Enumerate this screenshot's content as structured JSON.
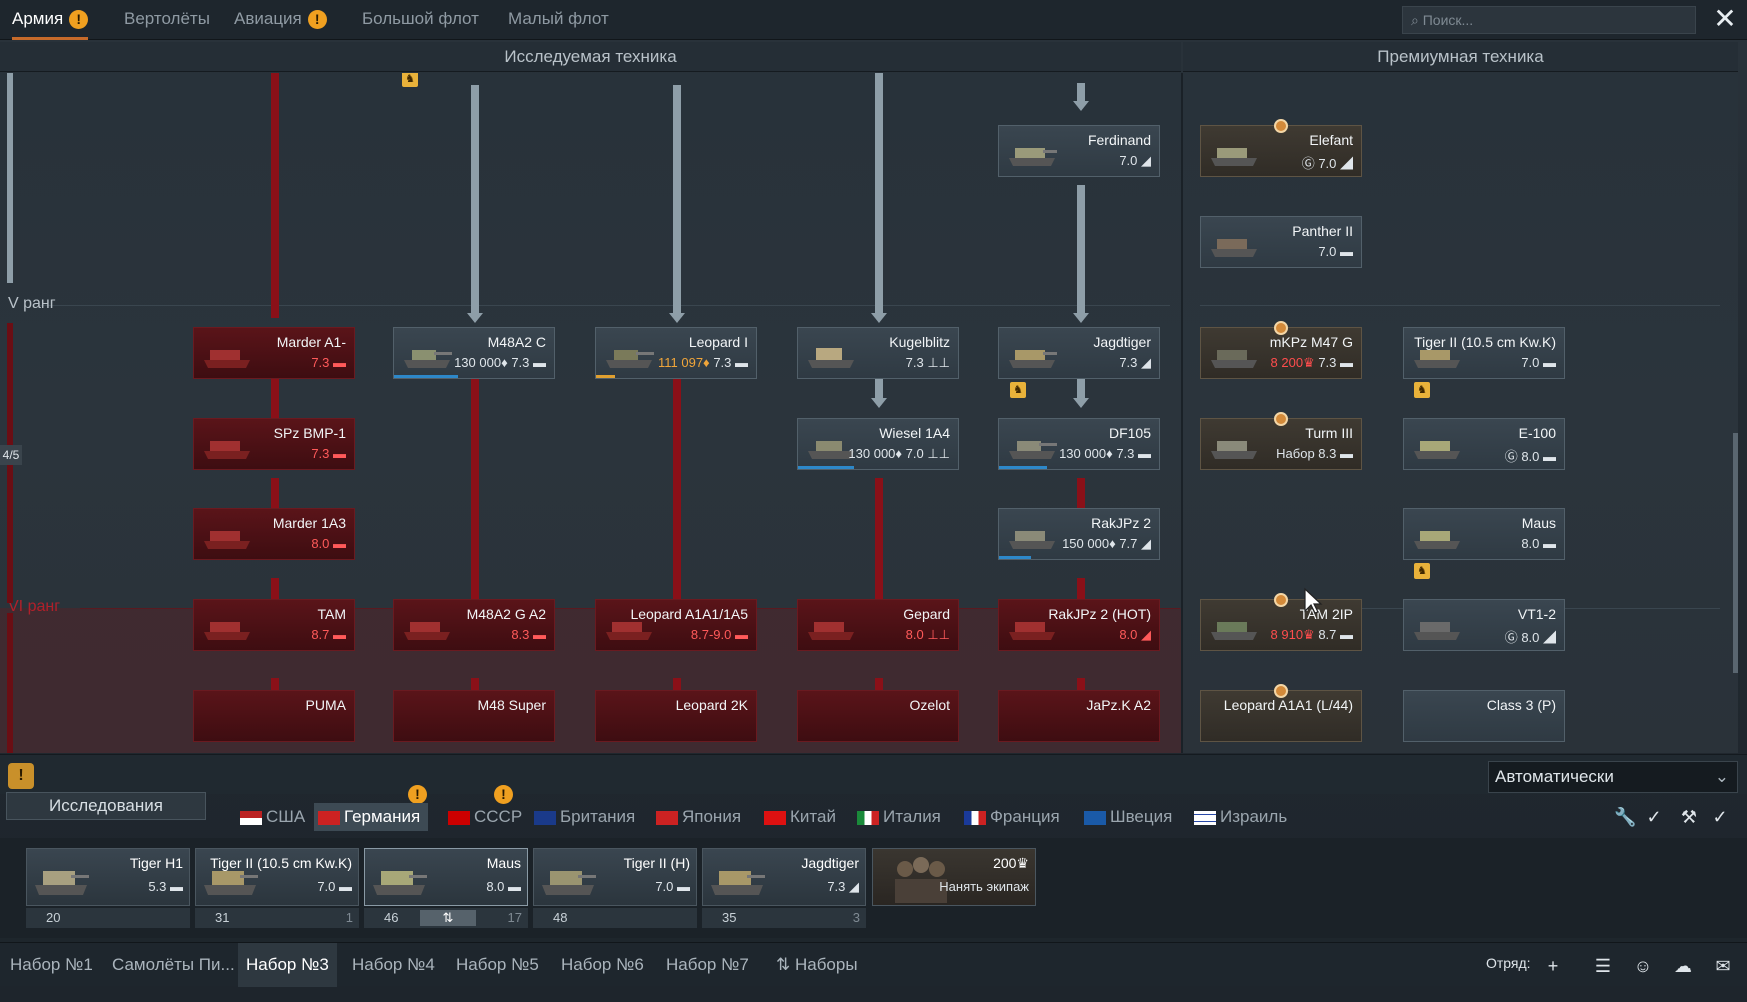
{
  "top_tabs": [
    {
      "label": "Армия",
      "warn": true
    },
    {
      "label": "Вертолёты",
      "warn": false
    },
    {
      "label": "Авиация",
      "warn": true
    },
    {
      "label": "Большой флот",
      "warn": false
    },
    {
      "label": "Малый флот",
      "warn": false
    }
  ],
  "warn_glyph": "!",
  "search_placeholder": "Поиск...",
  "close_glyph": "✕",
  "headers": {
    "research": "Исследуемая техника",
    "premium": "Премиумная техника"
  },
  "ranks": {
    "r5": "V ранг",
    "r6": "VI ранг"
  },
  "page_indicator": "4/5",
  "vehicles": [
    {
      "name": "Ferdinand",
      "stats": "7.0 ◢",
      "kind": "normal"
    },
    {
      "name": "Marder A1-",
      "stats": "7.3 ▬",
      "kind": "red"
    },
    {
      "name": "M48A2 C",
      "stats": "130 000♦ 7.3 ▬",
      "kind": "normal"
    },
    {
      "name": "Leopard I",
      "stats_gold": "111 097♦",
      "stats": " 7.3 ▬",
      "kind": "normal"
    },
    {
      "name": "Kugelblitz",
      "stats": "7.3 ⊥⊥",
      "kind": "normal"
    },
    {
      "name": "Jagdtiger",
      "stats": "7.3 ◢",
      "kind": "normal"
    },
    {
      "name": "SPz BMP-1",
      "stats": "7.3 ▬",
      "kind": "red"
    },
    {
      "name": "Wiesel 1A4",
      "stats": "130 000♦ 7.0 ⊥⊥",
      "kind": "normal"
    },
    {
      "name": "DF105",
      "stats": "130 000♦ 7.3 ▬",
      "kind": "normal"
    },
    {
      "name": "Marder 1A3",
      "stats": "8.0 ▬",
      "kind": "red"
    },
    {
      "name": "RakJPz 2",
      "stats": "150 000♦ 7.7 ◢",
      "kind": "normal"
    },
    {
      "name": "TAM",
      "stats": "8.7 ▬",
      "kind": "red"
    },
    {
      "name": "M48A2 G A2",
      "stats": "8.3 ▬",
      "kind": "red"
    },
    {
      "name": "Leopard A1A1/1A5",
      "stats": "8.7-9.0 ▬",
      "kind": "red"
    },
    {
      "name": "Gepard",
      "stats": "8.0 ⊥⊥",
      "kind": "red"
    },
    {
      "name": "RakJPz 2 (HOT)",
      "stats": "8.0 ◢",
      "kind": "red"
    },
    {
      "name": "PUMA",
      "stats": "",
      "kind": "red"
    },
    {
      "name": "M48 Super",
      "stats": "",
      "kind": "red"
    },
    {
      "name": "Leopard 2K",
      "stats": "",
      "kind": "red"
    },
    {
      "name": "Ozelot",
      "stats": "",
      "kind": "red"
    },
    {
      "name": "JaPz.K A2",
      "stats": "",
      "kind": "red"
    }
  ],
  "premium": [
    {
      "name": "Elefant",
      "stats": "Ⓖ 7.0 ◢"
    },
    {
      "name": "Panther II",
      "stats": "7.0 ▬"
    },
    {
      "name": "mKPz M47 G",
      "stats_red": "8 200♛",
      "stats": " 7.3 ▬"
    },
    {
      "name": "Tiger II (10.5 cm Kw.K)",
      "stats": "7.0 ▬"
    },
    {
      "name": "Turm III",
      "stats": "Набор 8.3 ▬"
    },
    {
      "name": "E-100",
      "stats": "Ⓖ 8.0 ▬"
    },
    {
      "name": "Maus",
      "stats": "8.0 ▬"
    },
    {
      "name": "TAM 2IP",
      "stats_red": "8 910♛",
      "stats": " 8.7 ▬"
    },
    {
      "name": "VT1-2",
      "stats": "Ⓖ 8.0 ◢"
    },
    {
      "name": "Leopard A1A1 (L/44)",
      "stats": ""
    },
    {
      "name": "Class 3 (P)",
      "stats": ""
    }
  ],
  "research_label": "Исследования",
  "auto_select": "Автоматически",
  "nations": [
    "США",
    "Германия",
    "СССР",
    "Британия",
    "Япония",
    "Китай",
    "Италия",
    "Франция",
    "Швеция",
    "Израиль"
  ],
  "crew": [
    {
      "name": "Tiger H1",
      "stats": "5.3 ▬",
      "crew": "20",
      "extra": ""
    },
    {
      "name": "Tiger II (10.5 cm Kw.K)",
      "stats": "7.0 ▬",
      "crew": "31",
      "extra": "1"
    },
    {
      "name": "Maus",
      "stats": "8.0 ▬",
      "crew": "46",
      "extra": "17"
    },
    {
      "name": "Tiger II (H)",
      "stats": "7.0 ▬",
      "crew": "48",
      "extra": ""
    },
    {
      "name": "Jagdtiger",
      "stats": "7.3 ◢",
      "crew": "35",
      "extra": "3"
    }
  ],
  "hire": {
    "price": "200♛",
    "label": "Нанять экипаж"
  },
  "presets": [
    "Набор №1",
    "Самолёты Пи...",
    "Набор №3",
    "Набор №4",
    "Набор №5",
    "Набор №6",
    "Набор №7",
    "Наборы"
  ],
  "squad_label": "Отряд:",
  "colors": {
    "accent": "#c66a2a",
    "warning": "#f0a020",
    "locked_red": "#8a1018"
  }
}
